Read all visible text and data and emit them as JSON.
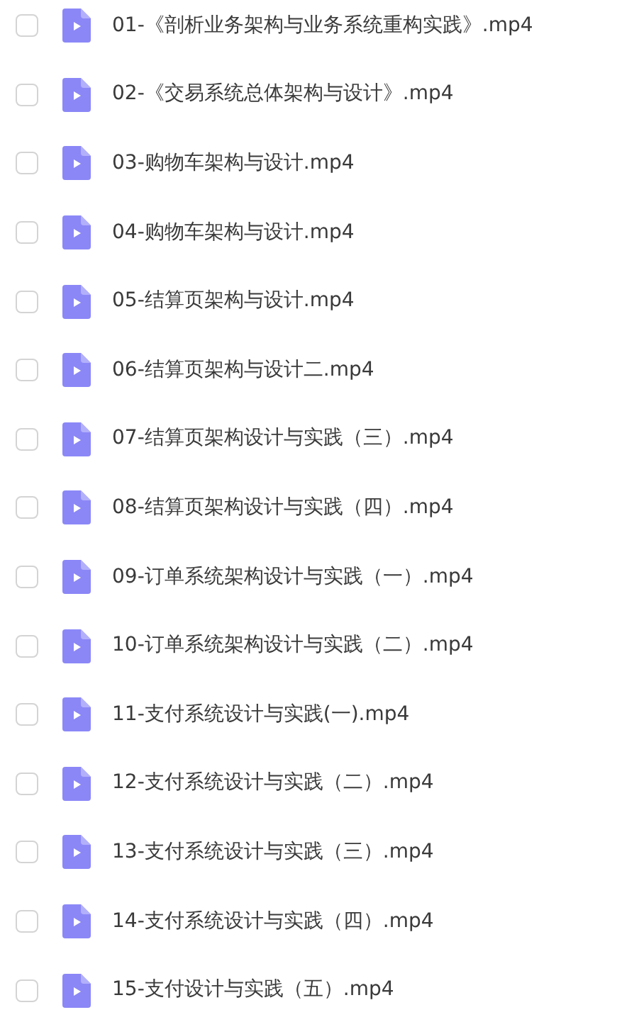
{
  "files": [
    {
      "name": "01-《剖析业务架构与业务系统重构实践》.mp4",
      "checked": false
    },
    {
      "name": "02-《交易系统总体架构与设计》.mp4",
      "checked": false
    },
    {
      "name": "03-购物车架构与设计.mp4",
      "checked": false
    },
    {
      "name": "04-购物车架构与设计.mp4",
      "checked": false
    },
    {
      "name": "05-结算页架构与设计.mp4",
      "checked": false
    },
    {
      "name": "06-结算页架构与设计二.mp4",
      "checked": false
    },
    {
      "name": "07-结算页架构设计与实践（三）.mp4",
      "checked": false
    },
    {
      "name": "08-结算页架构设计与实践（四）.mp4",
      "checked": false
    },
    {
      "name": "09-订单系统架构设计与实践（一）.mp4",
      "checked": false
    },
    {
      "name": "10-订单系统架构设计与实践（二）.mp4",
      "checked": false
    },
    {
      "name": "11-支付系统设计与实践(一).mp4",
      "checked": false
    },
    {
      "name": "12-支付系统设计与实践（二）.mp4",
      "checked": false
    },
    {
      "name": "13-支付系统设计与实践（三）.mp4",
      "checked": false
    },
    {
      "name": "14-支付系统设计与实践（四）.mp4",
      "checked": false
    },
    {
      "name": "15-支付设计与实践（五）.mp4",
      "checked": false
    }
  ]
}
